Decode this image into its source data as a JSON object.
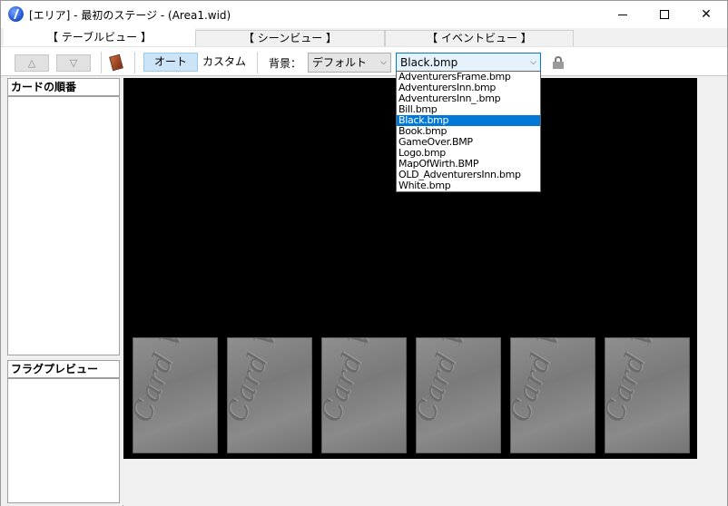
{
  "window": {
    "title": "[エリア] - 最初のステージ - (Area1.wid)",
    "min_label": "—",
    "close_label": "✕"
  },
  "tabs": [
    {
      "label": "【 テーブルビュー 】",
      "active": true
    },
    {
      "label": "【 シーンビュー 】",
      "active": false
    },
    {
      "label": "【 イベントビュー 】",
      "active": false
    }
  ],
  "toolbar": {
    "up_label": "△",
    "down_label": "▽",
    "card_tool_icon": "card-icon",
    "mode_auto_label": "オート",
    "mode_custom_label": "カスタム",
    "background_label": "背景：",
    "background_select_value": "デフォルト",
    "image_select_value": "Black.bmp",
    "lock_icon": "lock-icon"
  },
  "dropdown": {
    "options": [
      "AdventurersFrame.bmp",
      "AdventurersInn.bmp",
      "AdventurersInn_.bmp",
      "Bill.bmp",
      "Black.bmp",
      "Book.bmp",
      "GameOver.BMP",
      "Logo.bmp",
      "MapOfWirth.BMP",
      "OLD_AdventurersInn.bmp",
      "White.bmp"
    ],
    "selected_index": 4
  },
  "left_panel": {
    "card_order_title": "カードの順番",
    "flag_preview_title": "フラグプレビュー"
  },
  "stage": {
    "card_back_text": "Card Wirth",
    "card_count": 6
  }
}
